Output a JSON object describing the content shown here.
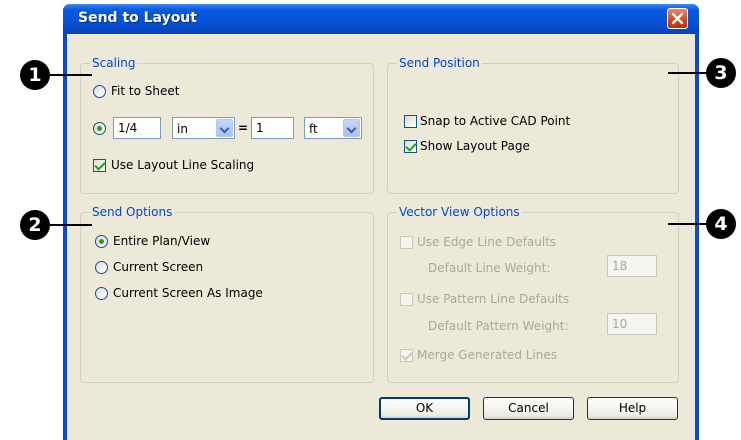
{
  "window": {
    "title": "Send to Layout"
  },
  "scaling": {
    "legend": "Scaling",
    "fit_to_sheet": "Fit to Sheet",
    "scale_value": "1/4",
    "scale_unit": "in",
    "equals": "=",
    "real_value": "1",
    "real_unit": "ft",
    "use_layout_line_scaling": "Use Layout Line Scaling"
  },
  "send_position": {
    "legend": "Send Position",
    "snap_to_cad_point": "Snap to Active CAD Point",
    "show_layout_page": "Show Layout Page"
  },
  "send_options": {
    "legend": "Send Options",
    "entire_plan_view": "Entire Plan/View",
    "current_screen": "Current Screen",
    "current_screen_as_image": "Current Screen As Image"
  },
  "vector_view": {
    "legend": "Vector View Options",
    "use_edge_line_defaults": "Use Edge Line Defaults",
    "default_line_weight_label": "Default Line Weight:",
    "default_line_weight_value": "18",
    "use_pattern_line_defaults": "Use Pattern Line Defaults",
    "default_pattern_weight_label": "Default Pattern Weight:",
    "default_pattern_weight_value": "10",
    "merge_generated_lines": "Merge Generated Lines"
  },
  "buttons": {
    "ok": "OK",
    "cancel": "Cancel",
    "help": "Help"
  },
  "callouts": [
    "1",
    "2",
    "3",
    "4"
  ]
}
